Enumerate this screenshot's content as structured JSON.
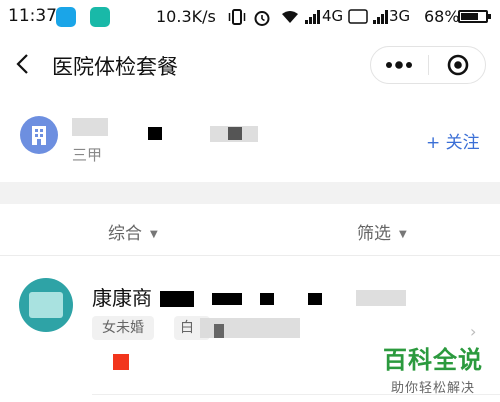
{
  "status_bar": {
    "time": "11:37",
    "speed": "10.3K/s",
    "network_primary": "4G",
    "network_secondary": "3G",
    "battery": "68%"
  },
  "nav": {
    "title": "医院体检套餐"
  },
  "hospital": {
    "level": "三甲",
    "follow_label": "+ 关注"
  },
  "filters": {
    "sort_label": "综合",
    "filter_label": "筛选"
  },
  "package": {
    "name": "康康商",
    "tags": [
      "女未婚",
      "白"
    ]
  },
  "watermark": {
    "title": "百科全说",
    "subtitle": "助你轻松解决"
  },
  "colors": {
    "accent_blue": "#3b6fd6",
    "watermark_green": "#2b9a3e",
    "red_marker": "#f2351c"
  }
}
